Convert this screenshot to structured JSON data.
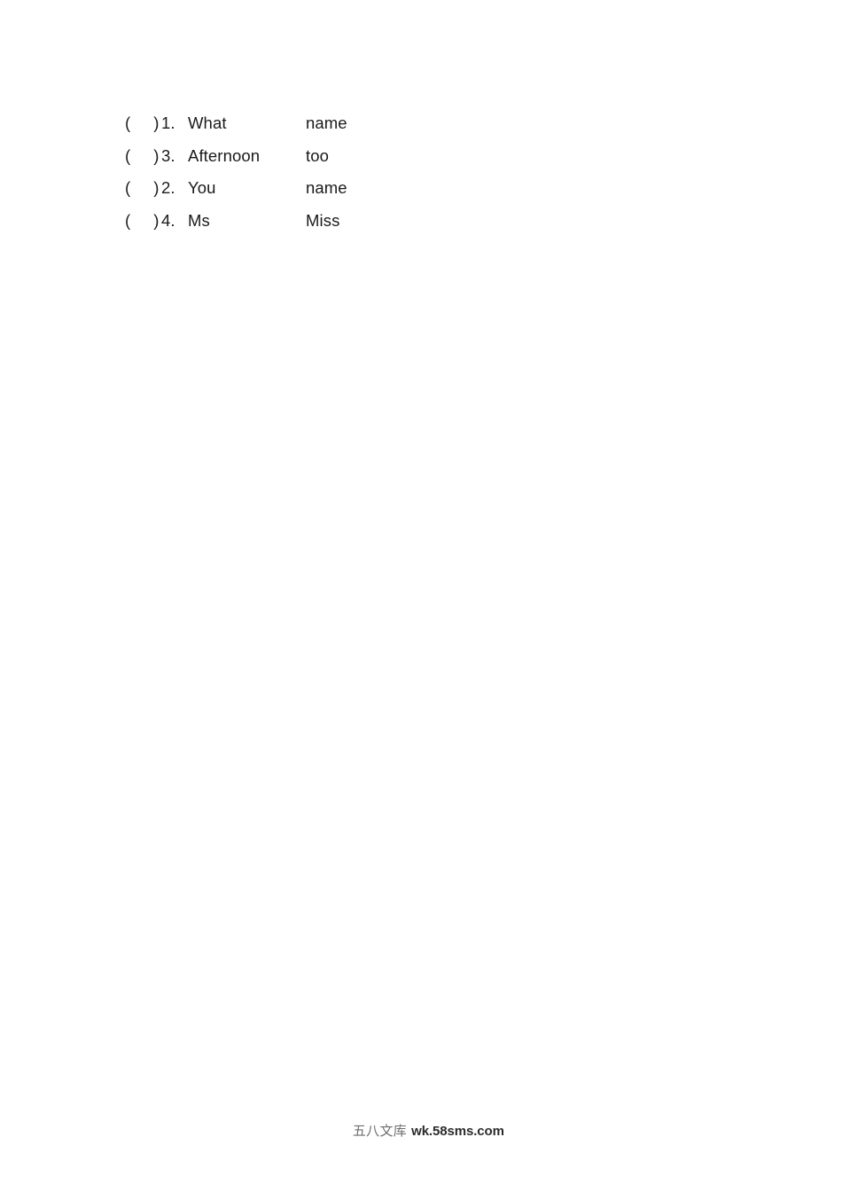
{
  "document": {
    "background_color": "#ffffff",
    "text_color": "#1a1a1a"
  },
  "exercise": {
    "bracket_open": "(",
    "bracket_close": ")",
    "rows": [
      {
        "number": "1.",
        "word_a": "What",
        "word_b": "name"
      },
      {
        "number": "3.",
        "word_a": "Afternoon",
        "word_b": "too"
      },
      {
        "number": "2.",
        "word_a": "You",
        "word_b": "name"
      },
      {
        "number": "4.",
        "word_a": "Ms",
        "word_b": "Miss"
      }
    ]
  },
  "watermark": {
    "site_name": "五八文库",
    "separator": " ",
    "url": "wk.58sms.com",
    "site_color": "#6e6e6e",
    "url_color": "#2b2b2b"
  }
}
